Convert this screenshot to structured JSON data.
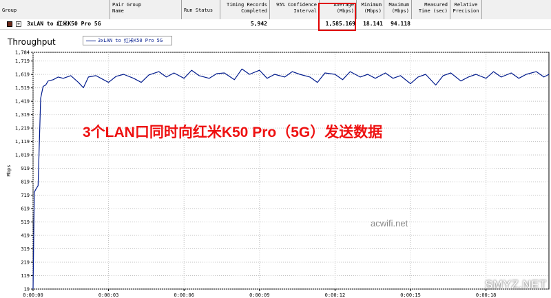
{
  "columns": [
    {
      "label": "Group"
    },
    {
      "label": "Pair Group\nName"
    },
    {
      "label": "Run Status"
    },
    {
      "label": "Timing Records\nCompleted"
    },
    {
      "label": "95% Confidence\nInterval"
    },
    {
      "label": "Average\n(Mbps)"
    },
    {
      "label": "Minimum\n(Mbps)"
    },
    {
      "label": "Maximum\n(Mbps)"
    },
    {
      "label": "Measured\nTime (sec)"
    },
    {
      "label": "Relative\nPrecision"
    }
  ],
  "row": {
    "group": "3xLAN to 红米K50 Pro 5G",
    "timing_records": "5,942",
    "average": "1,585.169",
    "minimum": "18.141",
    "maximum": "94.118"
  },
  "panel_title": "Throughput",
  "legend_text": "3xLAN to 红米K50 Pro 5G",
  "overlay_text": "3个LAN口同时向红米K50 Pro（5G）发送数据",
  "watermark": "acwifi.net",
  "site_mark": "SMYZ.NET",
  "colors": {
    "series": "#001a8c",
    "highlight": "#e00000",
    "overlay": "#ee1111"
  },
  "chart_data": {
    "type": "line",
    "ylabel": "Mbps",
    "xlabel": "",
    "ylim": [
      19,
      1784
    ],
    "y_ticks": [
      "1,784",
      "1,719",
      "1,619",
      "1,519",
      "1,419",
      "1,319",
      "1,219",
      "1,119",
      "1,019",
      "919",
      "819",
      "719",
      "619",
      "519",
      "419",
      "319",
      "219",
      "119",
      "19"
    ],
    "x_ticks": [
      "0:00:00",
      "0:00:03",
      "0:00:06",
      "0:00:09",
      "0:00:12",
      "0:00:15",
      "0:00:18"
    ],
    "xlim_seconds": [
      0,
      20.5
    ],
    "series": [
      {
        "x": [
          0,
          0.05,
          0.1,
          0.2,
          0.3,
          0.4,
          0.5,
          0.6,
          0.8,
          1,
          1.2,
          1.5,
          1.8,
          2,
          2.2,
          2.5,
          2.8,
          3,
          3.3,
          3.6,
          4,
          4.3,
          4.6,
          5,
          5.3,
          5.6,
          6,
          6.3,
          6.6,
          7,
          7.3,
          7.6,
          8,
          8.3,
          8.6,
          9,
          9.3,
          9.6,
          10,
          10.3,
          10.6,
          11,
          11.3,
          11.6,
          12,
          12.3,
          12.6,
          13,
          13.3,
          13.6,
          14,
          14.3,
          14.6,
          15,
          15.3,
          15.6,
          16,
          16.3,
          16.6,
          17,
          17.3,
          17.6,
          18,
          18.3,
          18.6,
          19,
          19.3,
          19.6,
          20,
          20.3,
          20.5
        ],
        "values": [
          19,
          740,
          760,
          790,
          1440,
          1530,
          1540,
          1570,
          1580,
          1600,
          1590,
          1610,
          1560,
          1520,
          1600,
          1610,
          1580,
          1560,
          1605,
          1620,
          1590,
          1560,
          1615,
          1640,
          1600,
          1630,
          1590,
          1650,
          1610,
          1590,
          1625,
          1630,
          1580,
          1660,
          1620,
          1650,
          1590,
          1620,
          1600,
          1640,
          1620,
          1600,
          1560,
          1630,
          1620,
          1580,
          1640,
          1600,
          1620,
          1590,
          1630,
          1590,
          1610,
          1550,
          1600,
          1620,
          1540,
          1610,
          1630,
          1570,
          1600,
          1620,
          1590,
          1640,
          1600,
          1630,
          1590,
          1620,
          1640,
          1600,
          1620
        ]
      }
    ]
  }
}
